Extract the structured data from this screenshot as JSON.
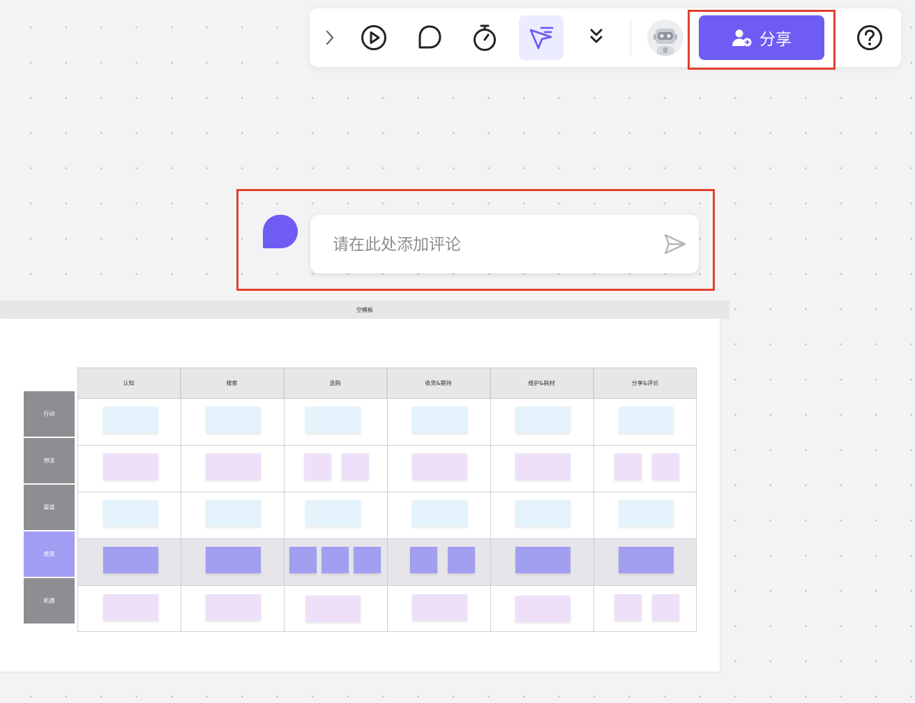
{
  "toolbar": {
    "icons": [
      "chevron-right-icon",
      "play-icon",
      "comment-icon",
      "timer-icon",
      "cursor-icon",
      "double-chevron-down-icon",
      "help-icon"
    ],
    "share_label": "分享",
    "accent_color": "#6f5cf3"
  },
  "comment": {
    "placeholder": "请在此处添加评论"
  },
  "board": {
    "title": "空模板",
    "columns": [
      "认知",
      "搜索",
      "选购",
      "收货&期待",
      "维护&耗材",
      "分享&评论"
    ],
    "rows": [
      "行动",
      "想法",
      "渠道",
      "感受",
      "机遇"
    ],
    "highlight_row": "感受",
    "colors": {
      "blue_note": "#e4f3fb",
      "pink_note": "#ede0f8",
      "purple_note": "#a29ef0",
      "row_label": "#8d8d92",
      "row_label_highlight": "#a29df3"
    }
  }
}
